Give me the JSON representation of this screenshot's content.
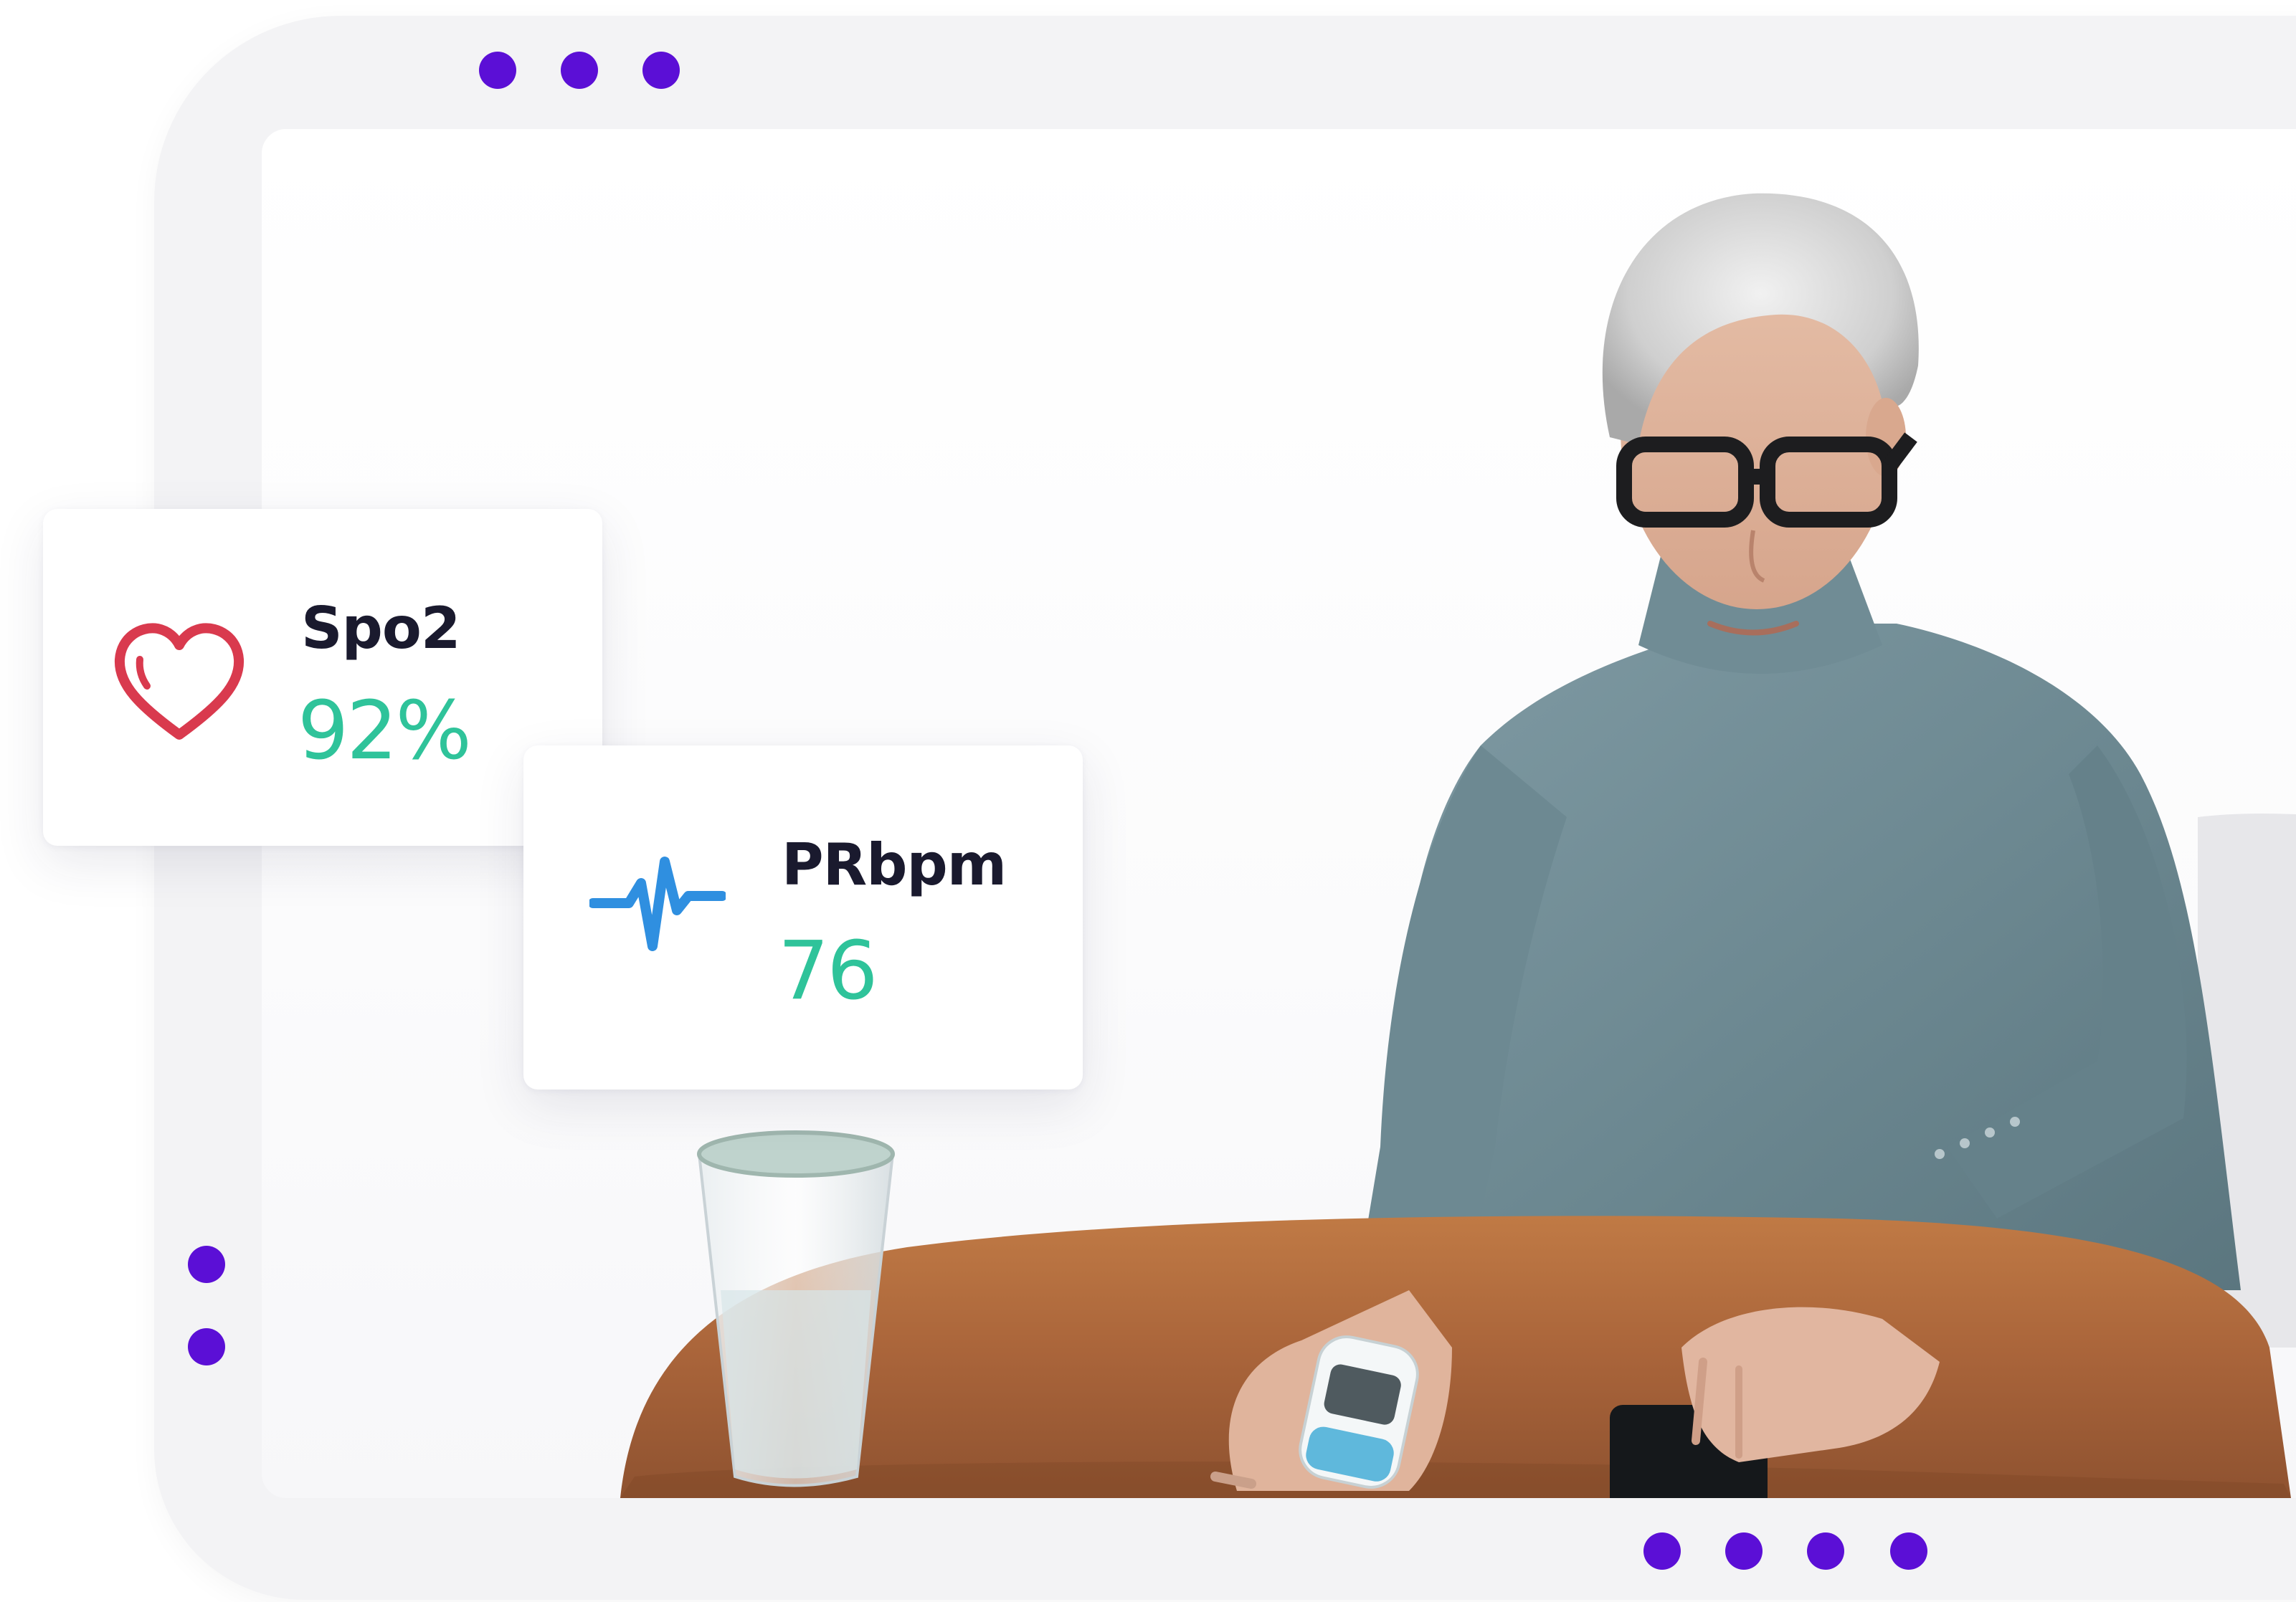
{
  "colors": {
    "accent_purple": "#5b0fd6",
    "value_green": "#2fc39a",
    "heart_red": "#d93a4e",
    "pulse_blue": "#2f8fe0",
    "label_dark": "#1a1a2e"
  },
  "decor": {
    "top_dots": 3,
    "left_dots": 2,
    "bottom_dots": 4
  },
  "metrics": [
    {
      "icon": "heart-icon",
      "label": "Spo2",
      "value": "92%"
    },
    {
      "icon": "pulse-wave-icon",
      "label": "PRbpm",
      "value": "76"
    }
  ]
}
